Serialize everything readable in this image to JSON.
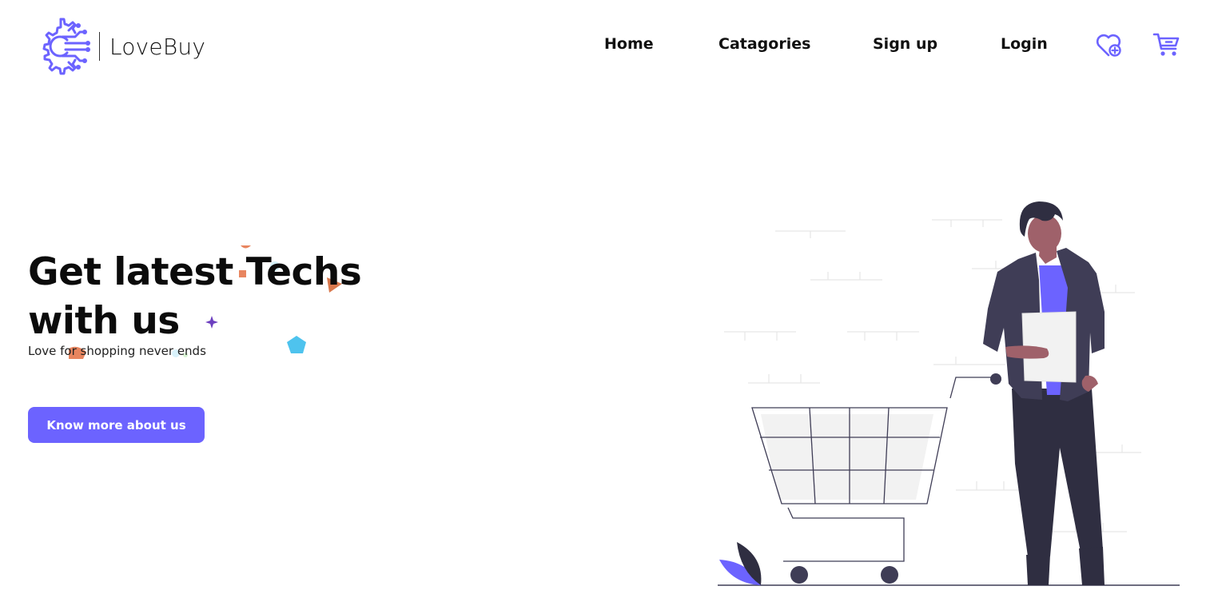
{
  "brand": {
    "name": "LoveBuy",
    "logo_icon": "circuit-gear-logo"
  },
  "nav": {
    "items": [
      {
        "label": "Home"
      },
      {
        "label": "Catagories"
      },
      {
        "label": "Sign up"
      },
      {
        "label": "Login"
      }
    ],
    "wishlist_icon": "heart-plus-icon",
    "cart_icon": "shopping-cart-icon"
  },
  "hero": {
    "title": "Get latest Techs with us",
    "subtitle": "Love for shopping never ends",
    "cta_label": "Know more about us"
  },
  "colors": {
    "accent": "#6c63ff",
    "dark_figure": "#2f2e41",
    "skin": "#9f616a",
    "confetti_orange": "#e8855f",
    "confetti_blue": "#4ec3ee",
    "confetti_purple": "#6c3fbf"
  },
  "illustration": {
    "description_icon": "man-with-shopping-cart-illustration"
  }
}
